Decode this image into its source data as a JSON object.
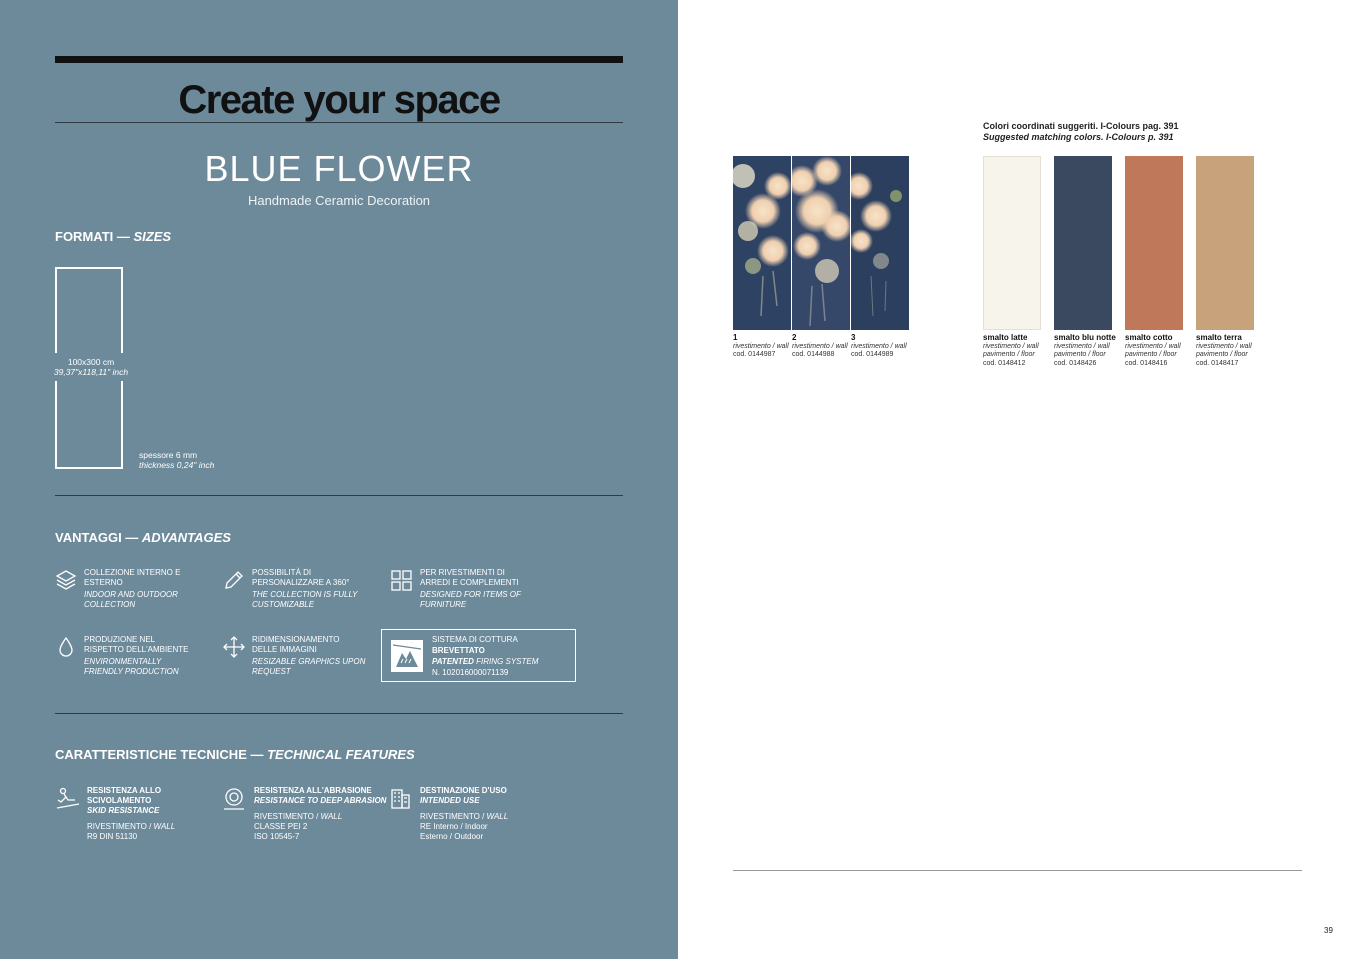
{
  "left": {
    "title": "Create your space",
    "collection_name": "BLUE FLOWER",
    "tagline": "Handmade Ceramic Decoration",
    "sizes_heading": "FORMATI — ",
    "sizes_heading_en": "SIZES",
    "tile_size_cm": "100x300 cm",
    "tile_size_inch": "39,37\"x118,11\" inch",
    "thickness_mm": "spessore 6 mm",
    "thickness_inch": "thickness 0,24\" inch",
    "advantages_heading": "VANTAGGI — ",
    "advantages_heading_en": "ADVANTAGES",
    "advantages": [
      {
        "icon": "layers-icon",
        "it_1": "COLLEZIONE INTERNO E",
        "it_2": "ESTERNO",
        "en_1": "INDOOR AND OUTDOOR",
        "en_2": "COLLECTION"
      },
      {
        "icon": "pencil-icon",
        "it_1": "POSSIBILITÀ DI",
        "it_2": "PERSONALIZZARE A 360°",
        "en_1": "THE COLLECTION IS FULLY",
        "en_2": "CUSTOMIZABLE"
      },
      {
        "icon": "grid-icon",
        "it_1": "PER RIVESTIMENTI DI",
        "it_2": "ARREDI E COMPLEMENTI",
        "en_1": "DESIGNED FOR ITEMS OF",
        "en_2": "FURNITURE"
      },
      {
        "icon": "drop-icon",
        "it_1": "PRODUZIONE NEL",
        "it_2": "RISPETTO DELL'AMBIENTE",
        "en_1": "ENVIRONMENTALLY",
        "en_2": "FRIENDLY PRODUCTION"
      },
      {
        "icon": "move-arrows-icon",
        "it_1": "RIDIMENSIONAMENTO",
        "it_2": "DELLE IMMAGINI",
        "en_1": "RESIZABLE GRAPHICS UPON",
        "en_2": "REQUEST"
      }
    ],
    "patent": {
      "line1": "SISTEMA DI COTTURA ",
      "line1_bold": "BREVETTATO",
      "line2_bold": "PATENTED",
      "line2": " FIRING SYSTEM",
      "number": "N. 102016000071139"
    },
    "features_heading": "CARATTERISTICHE TECNICHE — ",
    "features_heading_en": "TECHNICAL FEATURES",
    "features": [
      {
        "icon": "slip-icon",
        "l1": "RESISTENZA ALLO",
        "l2": "SCIVOLAMENTO",
        "l3": "SKID RESISTANCE",
        "v1": "RIVESTIMENTO / ",
        "v1i": "WALL",
        "v2": "R9 DIN 51130",
        "v3": ""
      },
      {
        "icon": "abrasion-icon",
        "l1": "RESISTENZA ALL'ABRASIONE",
        "l2": "",
        "l3": "RESISTANCE TO DEEP ABRASION",
        "v1": "RIVESTIMENTO / ",
        "v1i": "WALL",
        "v2": "CLASSE PEI 2",
        "v3": "ISO 10545-7"
      },
      {
        "icon": "building-icon",
        "l1": "DESTINAZIONE D'USO",
        "l2": "",
        "l3": "INTENDED USE",
        "v1": "RIVESTIMENTO / ",
        "v1i": "WALL",
        "v2": "RE Interno / Indoor",
        "v3": "Esterno / Outdoor"
      }
    ]
  },
  "right": {
    "coord_heading": "Colori coordinati suggeriti. I-Colours pag. 391",
    "coord_heading_en": "Suggested matching colors. I-Colours p. 391",
    "panels": [
      {
        "num": "1",
        "line1": "rivestimento / wall",
        "code": "cod. 0144987"
      },
      {
        "num": "2",
        "line1": "rivestimento / wall",
        "code": "cod. 0144988"
      },
      {
        "num": "3",
        "line1": "rivestimento / wall",
        "code": "cod. 0144989"
      }
    ],
    "swatches": [
      {
        "name": "smalto latte",
        "color": "#f7f4ec",
        "line1": "rivestimento / wall",
        "line2": "pavimento / floor",
        "code": "cod. 0148412"
      },
      {
        "name": "smalto blu notte",
        "color": "#3a4860",
        "line1": "rivestimento / wall",
        "line2": "pavimento / floor",
        "code": "cod. 0148426"
      },
      {
        "name": "smalto cotto",
        "color": "#c0785a",
        "line1": "rivestimento / wall",
        "line2": "pavimento / floor",
        "code": "cod. 0148416"
      },
      {
        "name": "smalto terra",
        "color": "#c7a27a",
        "line1": "rivestimento / wall",
        "line2": "pavimento / floor",
        "code": "cod. 0148417"
      }
    ],
    "page_number": "39"
  }
}
